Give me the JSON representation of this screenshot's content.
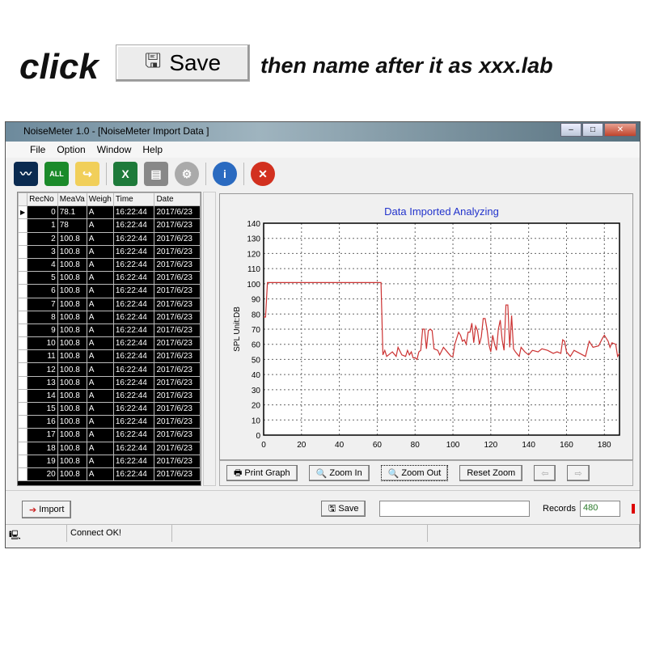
{
  "instruction": {
    "click": "click",
    "save_label": "Save",
    "rest": "then name after it as xxx.lab"
  },
  "window": {
    "title": "NoiseMeter 1.0  - [NoiseMeter Import Data ]"
  },
  "menu": [
    "File",
    "Option",
    "Window",
    "Help"
  ],
  "toolbar": [
    "waveform-icon",
    "download-all-icon",
    "open-folder-icon",
    "excel-icon",
    "printer-icon",
    "gear-icon",
    "info-icon",
    "close-red-icon"
  ],
  "toolbar_badge": "ALL",
  "table": {
    "columns": [
      "RecNo",
      "MeaVa",
      "Weigh",
      "Time",
      "Date"
    ],
    "rows": [
      [
        "0",
        "78.1",
        "A",
        "16:22:44",
        "2017/6/23"
      ],
      [
        "1",
        "78",
        "A",
        "16:22:44",
        "2017/6/23"
      ],
      [
        "2",
        "100.8",
        "A",
        "16:22:44",
        "2017/6/23"
      ],
      [
        "3",
        "100.8",
        "A",
        "16:22:44",
        "2017/6/23"
      ],
      [
        "4",
        "100.8",
        "A",
        "16:22:44",
        "2017/6/23"
      ],
      [
        "5",
        "100.8",
        "A",
        "16:22:44",
        "2017/6/23"
      ],
      [
        "6",
        "100.8",
        "A",
        "16:22:44",
        "2017/6/23"
      ],
      [
        "7",
        "100.8",
        "A",
        "16:22:44",
        "2017/6/23"
      ],
      [
        "8",
        "100.8",
        "A",
        "16:22:44",
        "2017/6/23"
      ],
      [
        "9",
        "100.8",
        "A",
        "16:22:44",
        "2017/6/23"
      ],
      [
        "10",
        "100.8",
        "A",
        "16:22:44",
        "2017/6/23"
      ],
      [
        "11",
        "100.8",
        "A",
        "16:22:44",
        "2017/6/23"
      ],
      [
        "12",
        "100.8",
        "A",
        "16:22:44",
        "2017/6/23"
      ],
      [
        "13",
        "100.8",
        "A",
        "16:22:44",
        "2017/6/23"
      ],
      [
        "14",
        "100.8",
        "A",
        "16:22:44",
        "2017/6/23"
      ],
      [
        "15",
        "100.8",
        "A",
        "16:22:44",
        "2017/6/23"
      ],
      [
        "16",
        "100.8",
        "A",
        "16:22:44",
        "2017/6/23"
      ],
      [
        "17",
        "100.8",
        "A",
        "16:22:44",
        "2017/6/23"
      ],
      [
        "18",
        "100.8",
        "A",
        "16:22:44",
        "2017/6/23"
      ],
      [
        "19",
        "100.8",
        "A",
        "16:22:44",
        "2017/6/23"
      ],
      [
        "20",
        "100.8",
        "A",
        "16:22:44",
        "2017/6/23"
      ]
    ]
  },
  "chart_data": {
    "type": "line",
    "title": "Data Imported  Analyzing",
    "xlabel": "",
    "ylabel": "SPL  Unit:DB",
    "xlim": [
      0,
      188
    ],
    "ylim": [
      0,
      140
    ],
    "xticks": [
      0,
      20,
      40,
      60,
      80,
      100,
      120,
      140,
      160,
      180
    ],
    "yticks": [
      0,
      10,
      20,
      30,
      40,
      50,
      60,
      70,
      80,
      90,
      100,
      110,
      120,
      130,
      140
    ],
    "grid": true,
    "grid_style": "dotted",
    "line_color": "#cc3333",
    "title_color": "#2233cc",
    "x": [
      0,
      1,
      2,
      62,
      63,
      64,
      65,
      66,
      68,
      70,
      71,
      73,
      75,
      76,
      77,
      78,
      79,
      80,
      81,
      82,
      83,
      84,
      85,
      86,
      87,
      88,
      89,
      90,
      92,
      93,
      95,
      97,
      99,
      100,
      101,
      103,
      104,
      105,
      106,
      107,
      108,
      109,
      110,
      111,
      112,
      113,
      114,
      115,
      116,
      117,
      118,
      119,
      120,
      121,
      122,
      123,
      124,
      125,
      126,
      127,
      128,
      129,
      130,
      131,
      132,
      133,
      135,
      136,
      138,
      140,
      142,
      145,
      147,
      150,
      153,
      155,
      157,
      158,
      159,
      160,
      162,
      164,
      167,
      170,
      172,
      174,
      177,
      179,
      180,
      182,
      183,
      184,
      186,
      187,
      188
    ],
    "y": [
      78,
      78,
      100.8,
      100.8,
      53,
      56,
      52,
      53,
      55,
      52,
      58,
      53,
      52,
      56,
      53,
      55,
      51,
      51,
      50,
      55,
      56,
      70,
      70,
      57,
      69,
      70,
      69,
      57,
      56,
      53,
      58,
      55,
      52,
      52,
      60,
      68,
      66,
      62,
      63,
      60,
      68,
      68,
      74,
      61,
      72,
      69,
      60,
      65,
      77,
      77,
      70,
      60,
      55,
      66,
      60,
      56,
      70,
      76,
      63,
      56,
      86,
      86,
      58,
      79,
      57,
      55,
      52,
      58,
      55,
      53,
      56,
      55,
      57,
      56,
      54,
      55,
      54,
      63,
      62,
      55,
      52,
      56,
      54,
      52,
      62,
      58,
      59,
      64,
      66,
      62,
      58,
      61,
      60,
      52,
      54
    ]
  },
  "chart_buttons": {
    "print": "Print Graph",
    "zoom_in": "Zoom In",
    "zoom_out": "Zoom Out",
    "reset": "Reset Zoom"
  },
  "bottom": {
    "import": "Import",
    "save": "Save",
    "file_value": "",
    "records_label": "Records",
    "records_value": "480"
  },
  "status": {
    "message": "Connect OK!"
  }
}
